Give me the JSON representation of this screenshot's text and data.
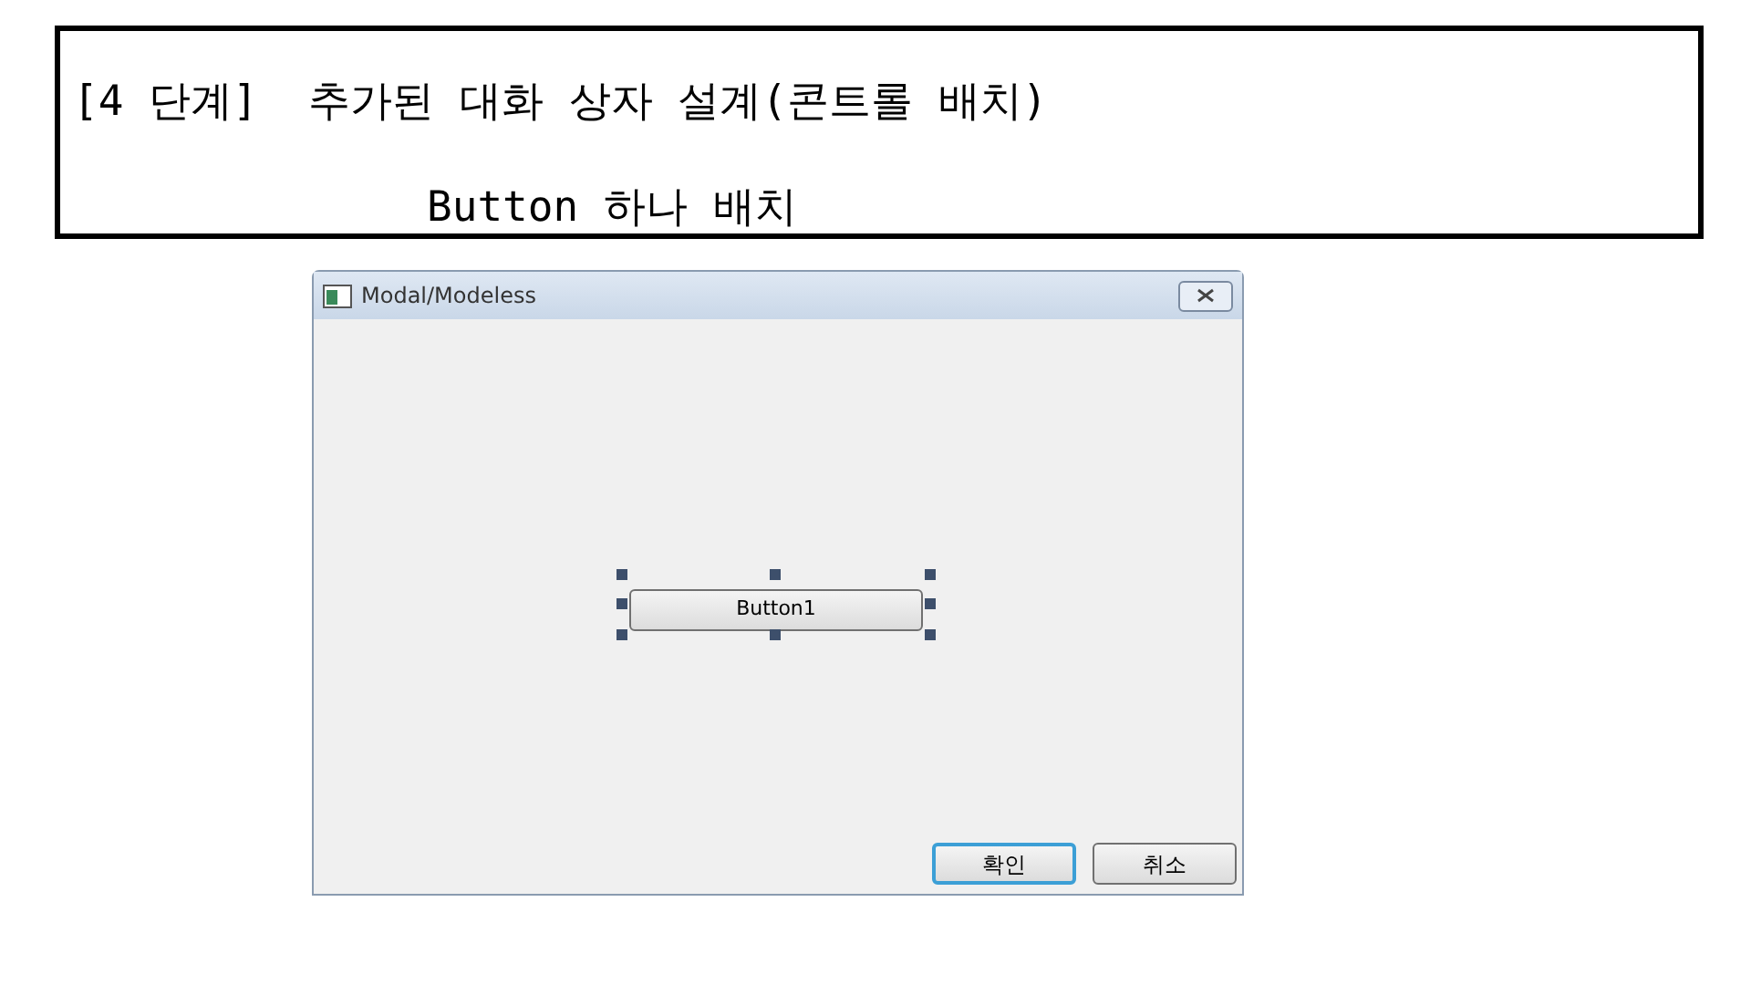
{
  "slide": {
    "title": "[4 단계]  추가된 대화 상자 설계(콘트롤 배치)",
    "subtitle": "Button 하나 배치"
  },
  "dialog": {
    "title": "Modal/Modeless",
    "control": {
      "label": "Button1",
      "selected": true
    },
    "buttons": [
      {
        "label": "확인",
        "default": true
      },
      {
        "label": "취소",
        "default": false
      }
    ]
  }
}
